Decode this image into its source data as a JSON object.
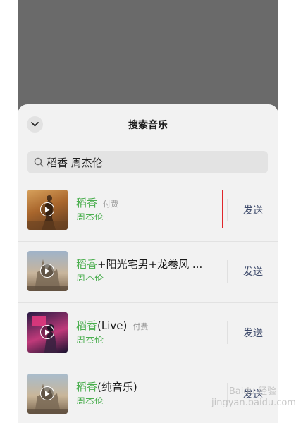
{
  "sheet": {
    "title": "搜索音乐",
    "collapse_icon": "chevron-down-icon"
  },
  "search": {
    "icon": "search-icon",
    "value": "稻香 周杰伦"
  },
  "results": [
    {
      "title_highlight": "稻香",
      "title_rest": "",
      "badge": "付费",
      "artist": "周杰伦",
      "send_label": "发送"
    },
    {
      "title_highlight": "稻香",
      "title_rest": "+阳光宅男+龙卷风 ...",
      "badge": "",
      "artist": "周杰伦",
      "send_label": "发送"
    },
    {
      "title_highlight": "稻香",
      "title_rest": " (Live)",
      "badge": "付费",
      "artist": "周杰伦",
      "send_label": "发送"
    },
    {
      "title_highlight": "稻香",
      "title_rest": " (纯音乐)",
      "badge": "",
      "artist": "周杰伦",
      "send_label": "发送"
    }
  ],
  "watermark": {
    "line1": "Baidu 经验",
    "line2": "jingyan.baidu.com"
  },
  "colors": {
    "highlight_green": "#4caf50",
    "send_text": "#3d4a6b",
    "annotation_red": "#e0262b",
    "backdrop": "#6a6a6a"
  }
}
